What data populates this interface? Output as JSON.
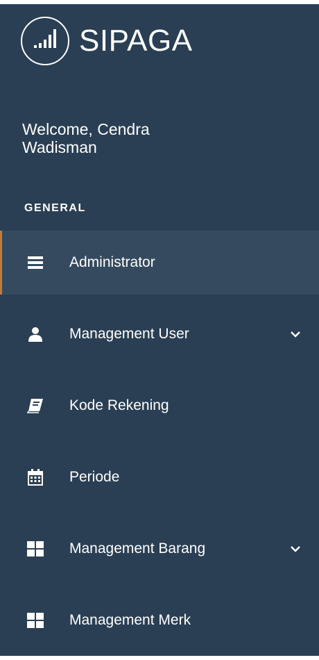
{
  "brand": {
    "name": "SIPAGA",
    "logo_icon": "signal-bars-icon"
  },
  "welcome": {
    "text": "Welcome, Cendra Wadisman"
  },
  "section": {
    "title": "GENERAL"
  },
  "colors": {
    "sidebar_bg": "#2a3f54",
    "active_bg": "#354a5e",
    "active_accent": "#c07c3b",
    "text": "#ffffff"
  },
  "nav": {
    "items": [
      {
        "label": "Administrator",
        "icon": "bars-icon",
        "active": true,
        "has_submenu": false
      },
      {
        "label": "Management User",
        "icon": "user-icon",
        "active": false,
        "has_submenu": true
      },
      {
        "label": "Kode Rekening",
        "icon": "book-icon",
        "active": false,
        "has_submenu": false
      },
      {
        "label": "Periode",
        "icon": "calendar-icon",
        "active": false,
        "has_submenu": false
      },
      {
        "label": "Management Barang",
        "icon": "grid-icon",
        "active": false,
        "has_submenu": true
      },
      {
        "label": "Management Merk",
        "icon": "grid-icon",
        "active": false,
        "has_submenu": false
      }
    ]
  }
}
